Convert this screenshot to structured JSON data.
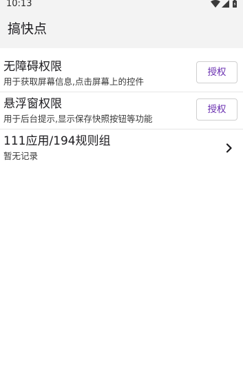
{
  "status_bar": {
    "time": "10:13",
    "icons": [
      "wifi-icon",
      "signal-icon",
      "battery-icon"
    ]
  },
  "app_bar": {
    "title": "搞快点"
  },
  "permissions": [
    {
      "title": "无障碍权限",
      "description": "用于获取屏幕信息,点击屏幕上的控件",
      "button_label": "授权"
    },
    {
      "title": "悬浮窗权限",
      "description": "用于后台提示,显示保存快照按钮等功能",
      "button_label": "授权"
    }
  ],
  "rules": {
    "title": "111应用/194规则组",
    "subtitle": "暂无记录",
    "icon": "chevron-right-icon"
  },
  "colors": {
    "accent": "#6a2fb0",
    "app_bar_bg": "#f3f3f3",
    "divider": "#e6e6e6"
  }
}
